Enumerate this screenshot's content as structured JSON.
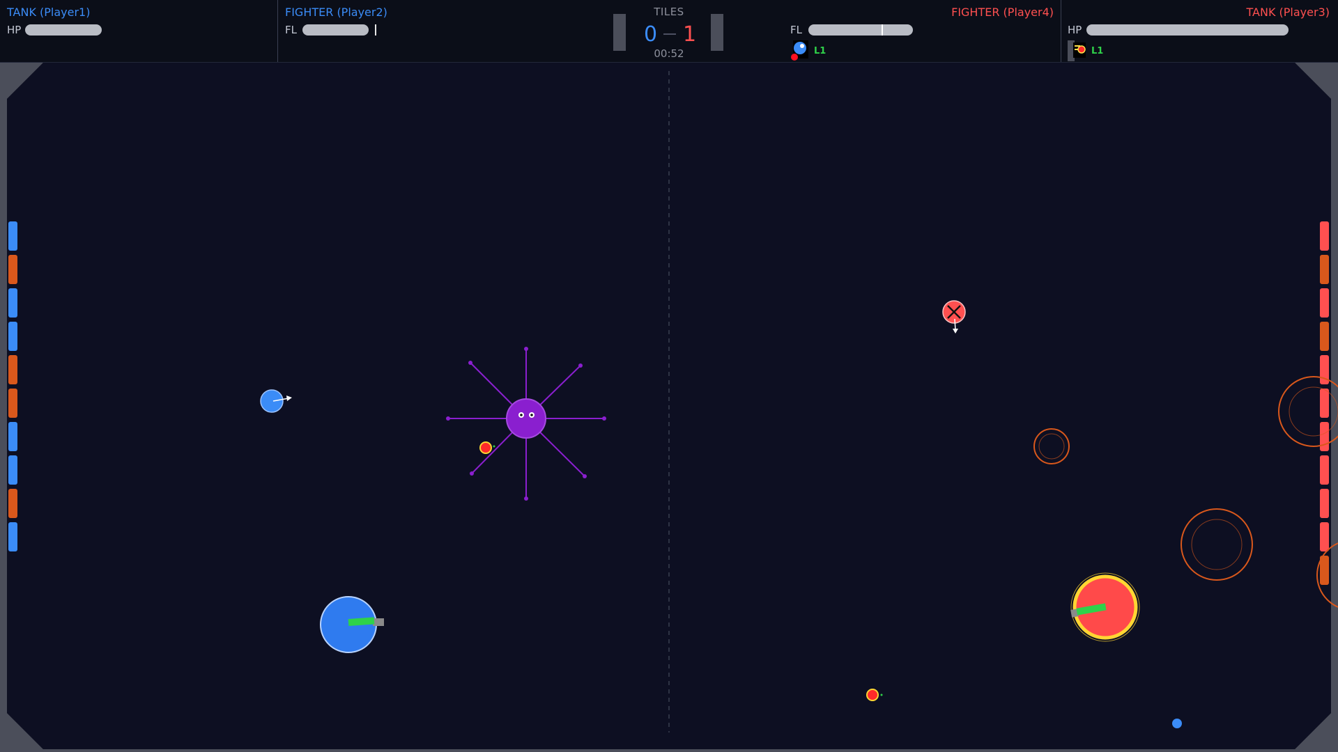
{
  "players": {
    "p1": {
      "name": "TANK (Player1)",
      "stat": "HP",
      "color": "#3b8cf7",
      "fill": 1.0
    },
    "p2": {
      "name": "FIGHTER (Player2)",
      "stat": "FL",
      "color": "#3b8cf7",
      "fill": 1.0
    },
    "p4": {
      "name": "FIGHTER (Player4)",
      "stat": "FL",
      "color": "#ff5050",
      "fill": 1.0,
      "level": "L1"
    },
    "p3": {
      "name": "TANK (Player3)",
      "stat": "HP",
      "color": "#ff5050",
      "fill": 1.0,
      "level": "L1"
    }
  },
  "score": {
    "label": "TILES",
    "blue": "0",
    "red": "1",
    "timer": "00:52"
  },
  "colors": {
    "blue": "#3b8cf7",
    "red": "#ff5050",
    "orange": "#d9581c",
    "purple": "#8a1fcf",
    "green": "#2fd24a",
    "field": "#0d0f22",
    "frame": "#4b4e5a"
  },
  "left_tiles": [
    "blue",
    "orange",
    "blue",
    "blue",
    "orange",
    "orange",
    "blue",
    "blue",
    "orange",
    "blue"
  ],
  "right_tiles": [
    "red",
    "orange",
    "red",
    "orange",
    "red",
    "red",
    "red",
    "red",
    "red",
    "red",
    "orange"
  ]
}
